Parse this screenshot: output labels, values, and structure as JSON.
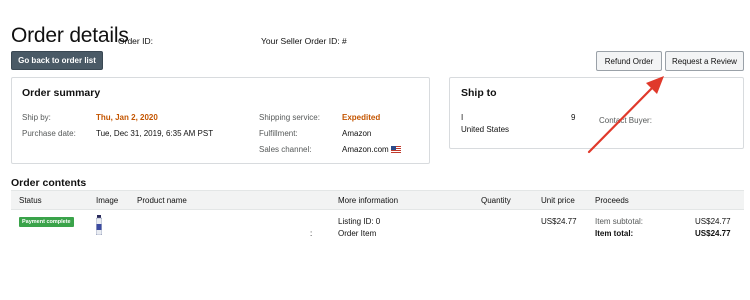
{
  "header": {
    "title": "Order details",
    "order_id_label": "Order ID:",
    "seller_order_id_label": "Your Seller Order ID: #",
    "back_button": "Go back to order list",
    "refund_button": "Refund Order",
    "review_button": "Request a Review"
  },
  "summary": {
    "title": "Order summary",
    "ship_by_label": "Ship by:",
    "ship_by_value": "Thu, Jan 2, 2020",
    "purchase_date_label": "Purchase date:",
    "purchase_date_value": "Tue, Dec 31, 2019, 6:35 AM PST",
    "shipping_service_label": "Shipping service:",
    "shipping_service_value": "Expedited",
    "fulfillment_label": "Fulfillment:",
    "fulfillment_value": "Amazon",
    "sales_channel_label": "Sales channel:",
    "sales_channel_value": "Amazon.com"
  },
  "ship_to": {
    "title": "Ship to",
    "line1": "I",
    "line1_suffix": "9",
    "country": "United States",
    "contact_label": "Contact Buyer:"
  },
  "contents": {
    "title": "Order contents",
    "columns": [
      "Status",
      "Image",
      "Product name",
      "More information",
      "Quantity",
      "Unit price",
      "Proceeds"
    ],
    "row": {
      "status_badge": "Payment complete",
      "product_name": ":",
      "listing_id": "Listing ID: 0",
      "order_item": "Order Item",
      "unit_price": "US$24.77",
      "item_subtotal_label": "Item subtotal:",
      "item_subtotal_value": "US$24.77",
      "item_total_label": "Item total:",
      "item_total_value": "US$24.77"
    }
  },
  "colors": {
    "accent_orange": "#c45500",
    "badge_green": "#3aa34a",
    "annotation_arrow": "#e0392b"
  }
}
